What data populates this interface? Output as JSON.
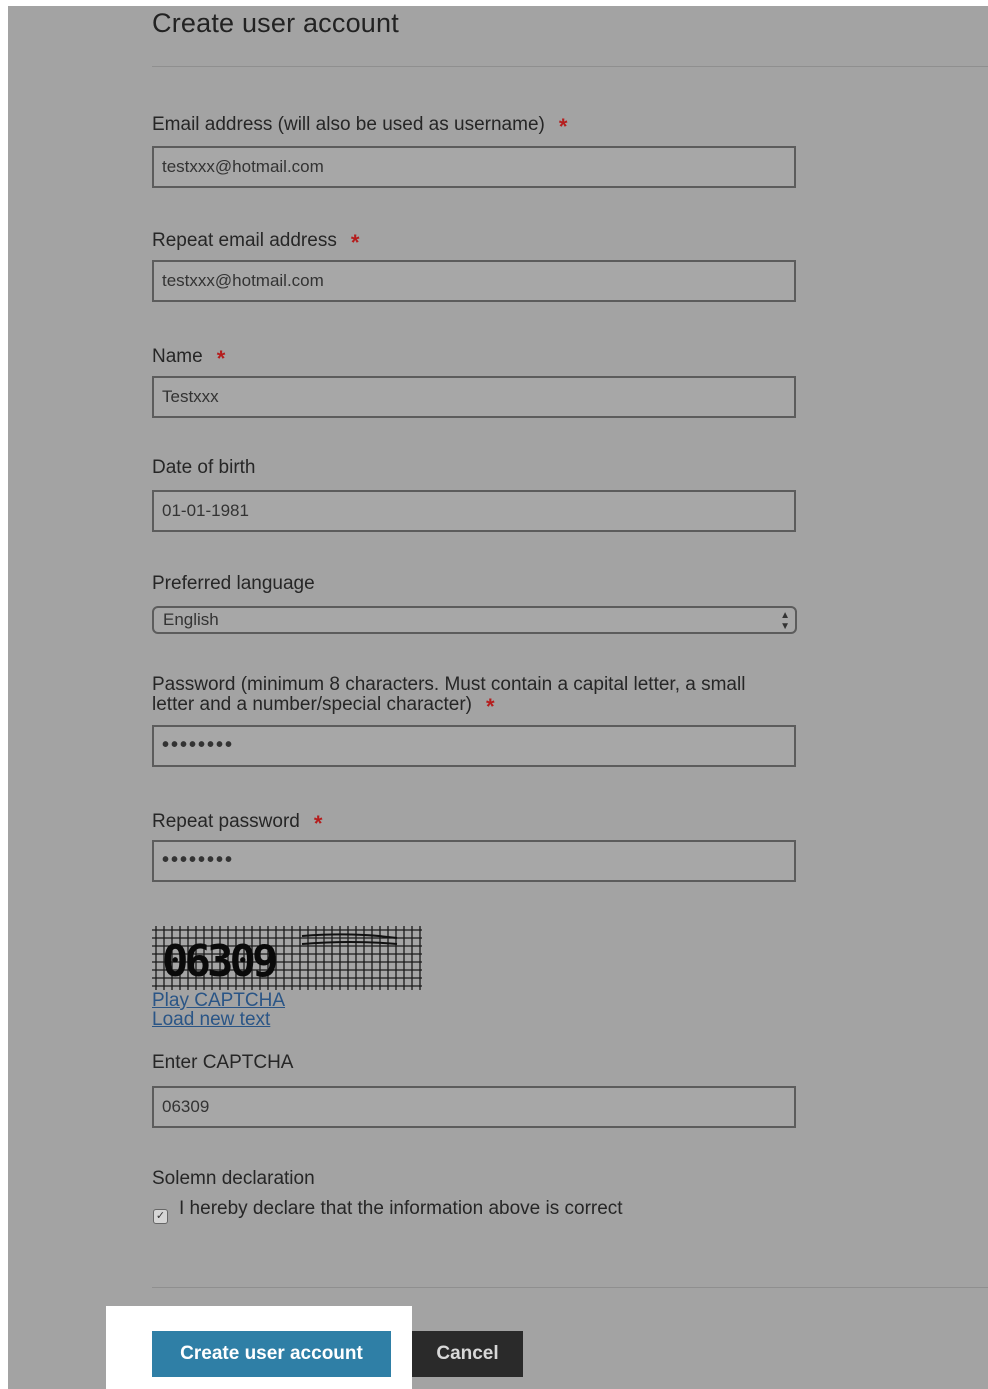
{
  "page_title": "Create user account",
  "fields": {
    "email": {
      "label": "Email address (will also be used as username)",
      "required_mark": "*",
      "value": "testxxx@hotmail.com"
    },
    "repeat_email": {
      "label": "Repeat email address",
      "required_mark": "*",
      "value": "testxxx@hotmail.com"
    },
    "name": {
      "label": "Name",
      "required_mark": "*",
      "value": "Testxxx"
    },
    "dob": {
      "label": "Date of birth",
      "value": "01-01-1981"
    },
    "language": {
      "label": "Preferred language",
      "value": "English"
    },
    "password": {
      "label_line1": "Password (minimum 8 characters. Must contain a capital letter, a small",
      "label_line2": "letter and a number/special character)",
      "required_mark": "*",
      "masked_value": "••••••••"
    },
    "repeat_password": {
      "label": "Repeat password",
      "required_mark": "*",
      "masked_value": "••••••••"
    }
  },
  "captcha": {
    "image_text": "06309",
    "play_link": "Play CAPTCHA",
    "reload_link": "Load new text",
    "input_label": "Enter CAPTCHA",
    "input_value": "06309"
  },
  "declaration": {
    "heading": "Solemn declaration",
    "checkbox_label": "I hereby declare that the information above is correct",
    "checked": true,
    "check_glyph": "✓"
  },
  "buttons": {
    "create": "Create user account",
    "cancel": "Cancel"
  },
  "colors": {
    "required": "#b51d1d",
    "primary_button": "#2f7fa6",
    "cancel_button": "#2a2a2a",
    "link": "#2a5586"
  }
}
